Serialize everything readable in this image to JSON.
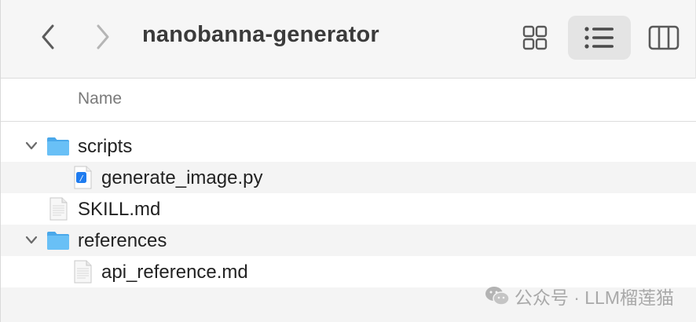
{
  "toolbar": {
    "title": "nanobanna-generator",
    "back_icon": "chevron-left-icon",
    "forward_icon": "chevron-right-icon",
    "view_modes": [
      {
        "name": "icon-view",
        "icon": "grid-icon",
        "selected": false
      },
      {
        "name": "list-view",
        "icon": "list-icon",
        "selected": true
      },
      {
        "name": "column-view",
        "icon": "columns-icon",
        "selected": false
      }
    ]
  },
  "columns": {
    "name": "Name"
  },
  "files": [
    {
      "label": "scripts",
      "type": "folder",
      "expanded": true,
      "level": 0
    },
    {
      "label": "generate_image.py",
      "type": "python-file",
      "level": 1
    },
    {
      "label": "SKILL.md",
      "type": "document",
      "level": 0
    },
    {
      "label": "references",
      "type": "folder",
      "expanded": true,
      "level": 0
    },
    {
      "label": "api_reference.md",
      "type": "document",
      "level": 1
    }
  ],
  "watermark": {
    "text": "公众号 · LLM榴莲猫",
    "icon": "wechat-icon"
  },
  "colors": {
    "folder": "#5ab4f0",
    "toolbar_bg": "#f6f6f6",
    "selected_view_bg": "#e4e4e4",
    "alt_row_bg": "#f4f4f4"
  }
}
